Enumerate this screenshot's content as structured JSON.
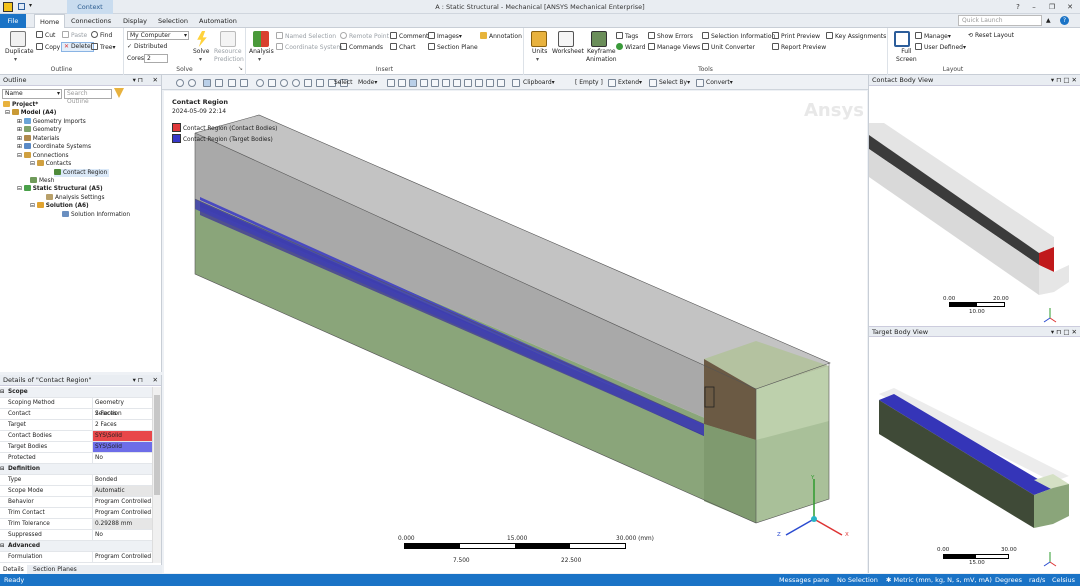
{
  "title_bar": {
    "app_title": "A : Static Structural - Mechanical [ANSYS Mechanical Enterprise]",
    "context_tab": "Context"
  },
  "tabs": {
    "file": "File",
    "items": [
      "Home",
      "Connections",
      "Display",
      "Selection",
      "Automation"
    ],
    "active": "Home"
  },
  "quick_launch": {
    "placeholder": "Quick Launch"
  },
  "ribbon": {
    "outline_group": {
      "label": "Outline",
      "duplicate": "Duplicate",
      "cut": "Cut",
      "copy": "Copy",
      "paste": "Paste",
      "delete": "Delete",
      "find": "Find",
      "tree": "Tree"
    },
    "solve_group": {
      "label": "Solve",
      "machine": "My Computer",
      "distributed": "Distributed",
      "cores_label": "Cores",
      "cores_value": "2",
      "solve": "Solve",
      "resource": "Resource",
      "prediction": "Prediction"
    },
    "insert_group": {
      "label": "Insert",
      "analysis": "Analysis",
      "named_selection": "Named Selection",
      "coordinate_system": "Coordinate System",
      "remote_point": "Remote Point",
      "commands": "Commands",
      "comment": "Comment",
      "chart": "Chart",
      "images": "Images",
      "section_plane": "Section Plane",
      "annotation": "Annotation"
    },
    "tools_group": {
      "label": "Tools",
      "units": "Units",
      "worksheet": "Worksheet",
      "keyframe": "Keyframe",
      "animation": "Animation",
      "tags": "Tags",
      "wizard": "Wizard",
      "show_errors": "Show Errors",
      "manage_views": "Manage Views",
      "selection_information": "Selection Information",
      "unit_converter": "Unit Converter",
      "print_preview": "Print Preview",
      "report_preview": "Report Preview",
      "key_assignments": "Key Assignments"
    },
    "layout_group": {
      "label": "Layout",
      "full": "Full",
      "screen": "Screen",
      "manage": "Manage",
      "user_defined": "User Defined",
      "reset_layout": "Reset Layout"
    }
  },
  "outline": {
    "title": "Outline",
    "name_filter": "Name",
    "search_placeholder": "Search Outline",
    "items": [
      {
        "label": "Project*",
        "bold": true
      },
      {
        "label": "Model (A4)",
        "bold": true
      },
      {
        "label": "Geometry Imports",
        "bold": false
      },
      {
        "label": "Geometry",
        "bold": false
      },
      {
        "label": "Materials",
        "bold": false
      },
      {
        "label": "Coordinate Systems",
        "bold": false
      },
      {
        "label": "Connections",
        "bold": false
      },
      {
        "label": "Contacts",
        "bold": false
      },
      {
        "label": "Contact Region",
        "bold": false
      },
      {
        "label": "Mesh",
        "bold": false
      },
      {
        "label": "Static Structural (A5)",
        "bold": true
      },
      {
        "label": "Analysis Settings",
        "bold": false
      },
      {
        "label": "Solution (A6)",
        "bold": true
      },
      {
        "label": "Solution Information",
        "bold": false
      }
    ]
  },
  "details": {
    "title": "Details of \"Contact Region\"",
    "rows": [
      {
        "key": "Scope",
        "value": "",
        "section": true
      },
      {
        "key": "Scoping Method",
        "value": "Geometry Selection"
      },
      {
        "key": "Contact",
        "value": "2 Faces"
      },
      {
        "key": "Target",
        "value": "2 Faces"
      },
      {
        "key": "Contact Bodies",
        "value": "SYS\\Solid",
        "color": "#e8474a"
      },
      {
        "key": "Target Bodies",
        "value": "SYS\\Solid",
        "color": "#6d6de8"
      },
      {
        "key": "Protected",
        "value": "No"
      },
      {
        "key": "Definition",
        "value": "",
        "section": true
      },
      {
        "key": "Type",
        "value": "Bonded"
      },
      {
        "key": "Scope Mode",
        "value": "Automatic",
        "shade": true
      },
      {
        "key": "Behavior",
        "value": "Program Controlled"
      },
      {
        "key": "Trim Contact",
        "value": "Program Controlled"
      },
      {
        "key": "Trim Tolerance",
        "value": "0.29288 mm",
        "shade": true
      },
      {
        "key": "Suppressed",
        "value": "No"
      },
      {
        "key": "Advanced",
        "value": "",
        "section": true
      },
      {
        "key": "Formulation",
        "value": "Program Controlled"
      }
    ],
    "tab_details": "Details",
    "tab_section_planes": "Section Planes"
  },
  "graphics_toolbar": {
    "select": "Select",
    "mode": "Mode",
    "clipboard": "Clipboard",
    "empty": "[ Empty ]",
    "extend": "Extend",
    "select_by": "Select By",
    "convert": "Convert"
  },
  "viewport": {
    "heading": "Contact Region",
    "date": "2024-05-09 22:14",
    "watermark": "Ansys",
    "legend": [
      {
        "label": "Contact Region (Contact Bodies)",
        "color": "#e0393b"
      },
      {
        "label": "Contact Region (Target Bodies)",
        "color": "#3838c8"
      }
    ],
    "scale_ticks_top": [
      "0.000",
      "15.000",
      "30.000 (mm)"
    ],
    "scale_ticks_bottom": [
      "7.500",
      "22.500"
    ],
    "axes": {
      "x": "X",
      "y": "Y",
      "z": "Z"
    }
  },
  "contact_view": {
    "title": "Contact Body View",
    "scale_ticks_top": [
      "0.00",
      "20.00"
    ],
    "scale_ticks_bottom": [
      "10.00"
    ]
  },
  "target_view": {
    "title": "Target Body View",
    "scale_ticks_top": [
      "0.00",
      "30.00"
    ],
    "scale_ticks_bottom": [
      "15.00"
    ]
  },
  "status_bar": {
    "ready": "Ready",
    "messages": "Messages pane",
    "selection": "No Selection",
    "units": "Metric (mm, kg, N, s, mV, mA)",
    "angle": "Degrees",
    "rotation": "rad/s",
    "temperature": "Celsius"
  },
  "colors": {
    "accent": "#1a73c6",
    "contact_body": "#e0393b",
    "target_body": "#3838c8",
    "body_green": "#8aa57a"
  }
}
